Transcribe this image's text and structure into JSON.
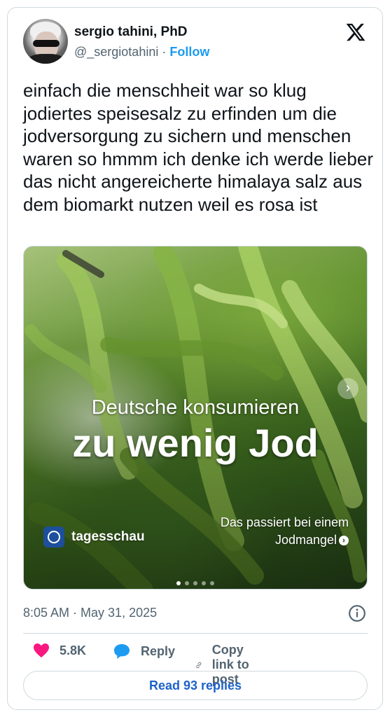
{
  "author": {
    "name": "sergio tahini, PhD",
    "handle": "@_sergiotahini",
    "separator": "·",
    "follow_label": "Follow"
  },
  "tweet": {
    "text": "einfach die menschheit war so klug jodiertes speisesalz zu erfinden um die jodversorgung zu sichern und menschen waren so hmmm ich denke ich werde lieber das nicht angereicherte himalaya salz aus dem biomarkt nutzen weil es rosa ist"
  },
  "media": {
    "headline_small": "Deutsche konsumieren",
    "headline_big": "zu wenig Jod",
    "brand": "tagesschau",
    "cta_line1": "Das passiert bei einem",
    "cta_line2": "Jodmangel",
    "carousel_total": 5,
    "carousel_active": 1
  },
  "meta": {
    "timestamp": "8:05 AM · May 31, 2025"
  },
  "actions": {
    "likes": "5.8K",
    "reply": "Reply",
    "copy_link": "Copy link to post"
  },
  "read_replies": "Read 93 replies",
  "colors": {
    "accent": "#1d9bf0",
    "like": "#f91880",
    "reply_icon": "#1d9bf0",
    "secondary_text": "#536471",
    "border": "#cfd9de"
  }
}
